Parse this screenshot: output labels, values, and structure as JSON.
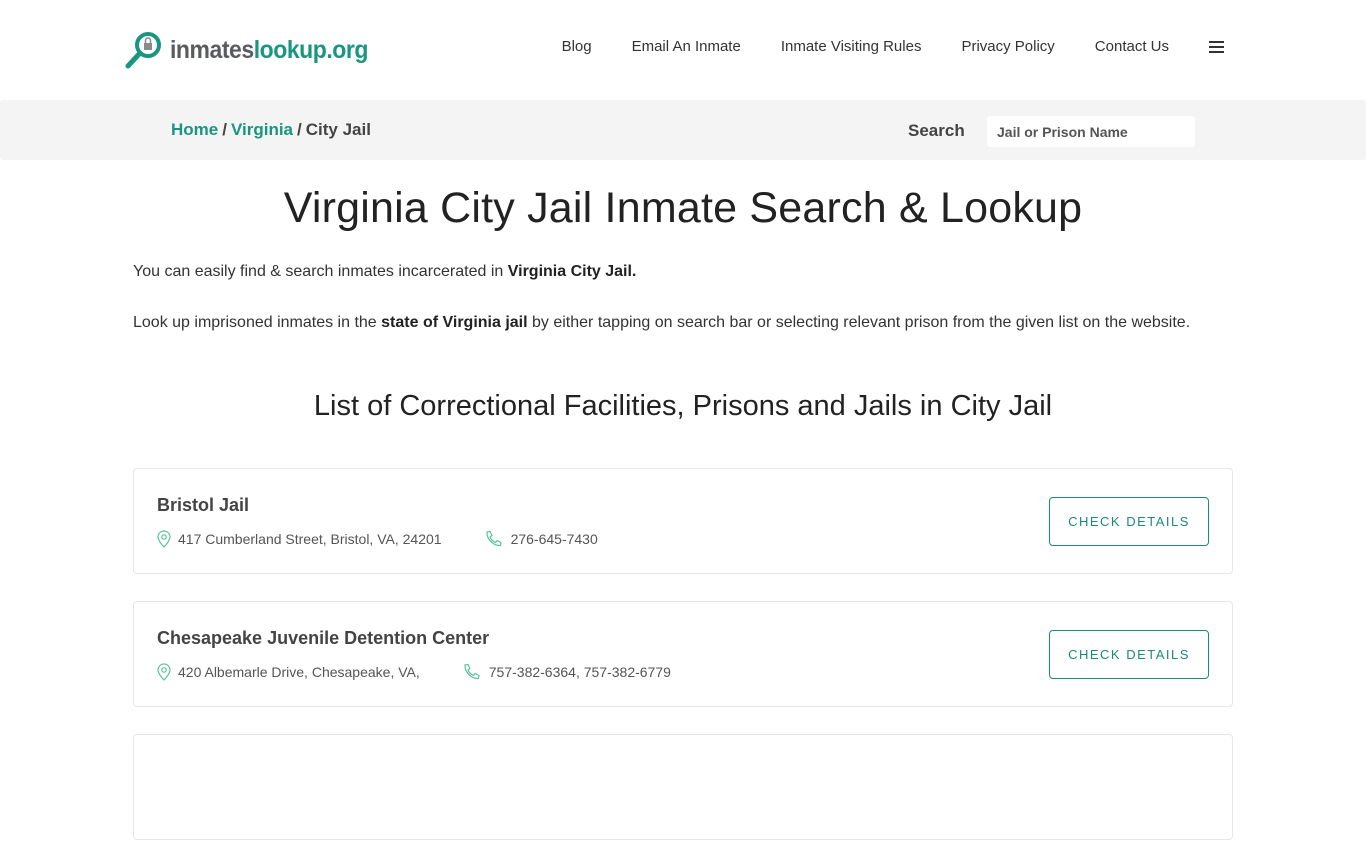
{
  "header": {
    "logo": {
      "part1": "inmates",
      "part2": "lookup.org",
      "icon": "magnifier-lock-icon"
    },
    "nav": [
      {
        "label": "Blog"
      },
      {
        "label": "Email An Inmate"
      },
      {
        "label": "Inmate Visiting Rules"
      },
      {
        "label": "Privacy Policy"
      },
      {
        "label": "Contact Us"
      }
    ],
    "menu_icon": "hamburger-icon"
  },
  "subbar": {
    "breadcrumb": [
      {
        "label": "Home"
      },
      {
        "label": "Virginia"
      },
      {
        "label": "City Jail"
      }
    ],
    "separator": "/",
    "search_label": "Search",
    "search_placeholder": "Jail or Prison Name"
  },
  "main": {
    "title": "Virginia City Jail Inmate Search & Lookup",
    "p1": {
      "text": "You can easily find & search inmates incarcerated in ",
      "bold": "Virginia City Jail."
    },
    "p2": {
      "pre": "Look up imprisoned inmates in the ",
      "bold": "state of Virginia jail",
      "post": " by either tapping on search bar or selecting relevant prison from the given list on the website."
    },
    "list_title": "List of Correctional Facilities, Prisons and Jails in City Jail",
    "facilities": [
      {
        "name": "Bristol Jail",
        "address": "417 Cumberland Street, Bristol, VA, 24201",
        "phone": "276-645-7430",
        "button": "CHECK DETAILS"
      },
      {
        "name": "Chesapeake Juvenile Detention Center",
        "address": "420 Albemarle Drive, Chesapeake, VA,",
        "phone": "757-382-6364, 757-382-6779",
        "button": "CHECK DETAILS"
      },
      {
        "name": "",
        "address": "",
        "phone": "",
        "button": ""
      }
    ]
  },
  "colors": {
    "accent": "#1a9680",
    "logo_gray": "#5a5b5d",
    "subbar_bg": "#f4f4f4"
  }
}
